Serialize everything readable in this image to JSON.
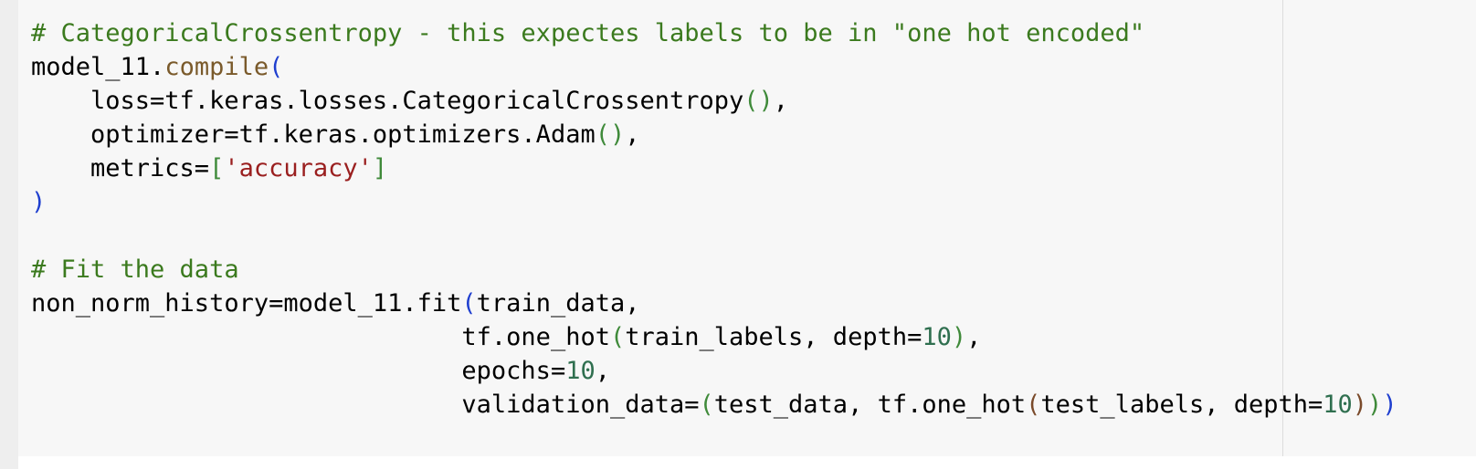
{
  "code_cell": {
    "lines": [
      [
        {
          "t": "# CategoricalCrossentropy - this expectes labels to be in \"one hot encoded\"",
          "c": "comment"
        }
      ],
      [
        {
          "t": "model_11.",
          "c": "default"
        },
        {
          "t": "compile",
          "c": "function"
        },
        {
          "t": "(",
          "c": "paren-blue"
        }
      ],
      [
        {
          "t": "    loss=tf.keras.losses.CategoricalCrossentropy",
          "c": "default"
        },
        {
          "t": "()",
          "c": "paren-green"
        },
        {
          "t": ",",
          "c": "default"
        }
      ],
      [
        {
          "t": "    optimizer=tf.keras.optimizers.Adam",
          "c": "default"
        },
        {
          "t": "()",
          "c": "paren-green"
        },
        {
          "t": ",",
          "c": "default"
        }
      ],
      [
        {
          "t": "    metrics=",
          "c": "default"
        },
        {
          "t": "[",
          "c": "paren-green"
        },
        {
          "t": "'accuracy'",
          "c": "string"
        },
        {
          "t": "]",
          "c": "paren-green"
        }
      ],
      [
        {
          "t": ")",
          "c": "paren-blue"
        }
      ],
      [],
      [
        {
          "t": "# Fit the data",
          "c": "comment"
        }
      ],
      [
        {
          "t": "non_norm_history=model_11.fit",
          "c": "default"
        },
        {
          "t": "(",
          "c": "paren-blue"
        },
        {
          "t": "train_data,",
          "c": "default"
        }
      ],
      [
        {
          "t": "                             tf.one_hot",
          "c": "default"
        },
        {
          "t": "(",
          "c": "paren-green"
        },
        {
          "t": "train_labels, depth=",
          "c": "default"
        },
        {
          "t": "10",
          "c": "number"
        },
        {
          "t": ")",
          "c": "paren-green"
        },
        {
          "t": ",",
          "c": "default"
        }
      ],
      [
        {
          "t": "                             epochs=",
          "c": "default"
        },
        {
          "t": "10",
          "c": "number"
        },
        {
          "t": ",",
          "c": "default"
        }
      ],
      [
        {
          "t": "                             validation_data=",
          "c": "default"
        },
        {
          "t": "(",
          "c": "paren-green"
        },
        {
          "t": "test_data, tf.one_hot",
          "c": "default"
        },
        {
          "t": "(",
          "c": "paren-brown"
        },
        {
          "t": "test_labels, depth=",
          "c": "default"
        },
        {
          "t": "10",
          "c": "number"
        },
        {
          "t": ")",
          "c": "paren-brown"
        },
        {
          "t": ")",
          "c": "paren-green"
        },
        {
          "t": ")",
          "c": "paren-blue"
        }
      ]
    ]
  }
}
